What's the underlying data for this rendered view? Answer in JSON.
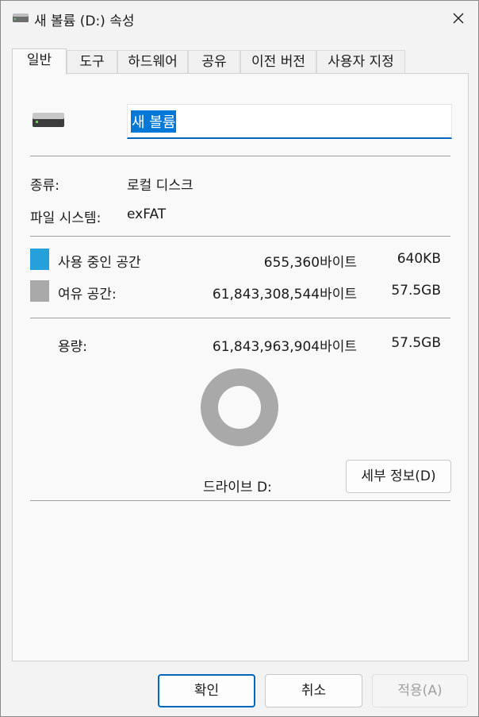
{
  "window": {
    "title": "새 볼륨 (D:) 속성",
    "close_glyph": "✕"
  },
  "tabs": [
    {
      "label": "일반",
      "active": true
    },
    {
      "label": "도구",
      "active": false
    },
    {
      "label": "하드웨어",
      "active": false
    },
    {
      "label": "공유",
      "active": false
    },
    {
      "label": "이전 버전",
      "active": false
    },
    {
      "label": "사용자 지정",
      "active": false
    }
  ],
  "general": {
    "volume_name": "새 볼륨",
    "type_label": "종류:",
    "type_value": "로컬 디스크",
    "fs_label": "파일 시스템:",
    "fs_value": "exFAT",
    "used_label": "사용 중인 공간",
    "used_bytes": "655,360바이트",
    "used_short": "640KB",
    "free_label": "여유 공간:",
    "free_bytes": "61,843,308,544바이트",
    "free_short": "57.5GB",
    "capacity_label": "용량:",
    "capacity_bytes": "61,843,963,904바이트",
    "capacity_short": "57.5GB",
    "drive_label": "드라이브 D:",
    "details_button": "세부 정보(D)",
    "used_fraction": 1.06e-05
  },
  "colors": {
    "used": "#26a0da",
    "free": "#a9a9a9",
    "accent": "#0067c0"
  },
  "buttons": {
    "ok": "확인",
    "cancel": "취소",
    "apply": "적용(A)"
  }
}
